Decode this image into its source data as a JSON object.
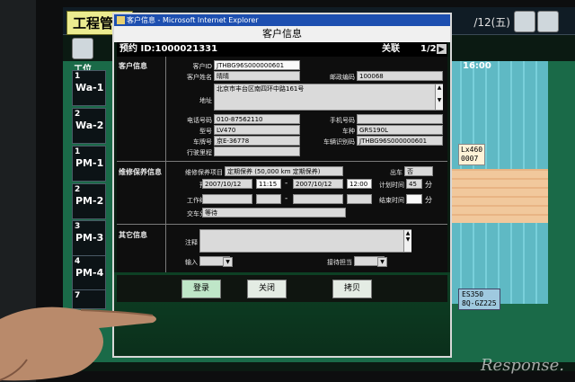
{
  "background_app": {
    "title": "工程管理",
    "date": "/12(五)",
    "time_label": "16:00",
    "column_header": "工位",
    "rows": [
      {
        "num": "1",
        "label": "Wa-1"
      },
      {
        "num": "2",
        "label": "Wa-2"
      },
      {
        "num": "1",
        "label": "PM-1"
      },
      {
        "num": "2",
        "label": "PM-2"
      },
      {
        "num": "3",
        "label": "PM-3"
      },
      {
        "num": "4",
        "label": "PM-4"
      },
      {
        "num": "7",
        "label": ""
      }
    ],
    "card1": "Lx460\n0007",
    "card2": "ES350\n8Q-GZ225"
  },
  "window": {
    "title": "客户信息 - Microsoft Internet Explorer",
    "header": "客户信息"
  },
  "record": {
    "id_label": "预约 ID:1000021331",
    "close_label": "关联",
    "pager": "1/2",
    "next_icon": "▶"
  },
  "customer": {
    "section": "客户信息",
    "customer_id_label": "客户ID",
    "customer_id": "JTHBG96S000000601",
    "name_label": "客户姓名",
    "name": "晴晴",
    "postcode_label": "邮政编码",
    "postcode": "100068",
    "address_label": "地址",
    "address": "北京市丰台区南四环中路161号",
    "phone_label": "电话号码",
    "phone": "010-87562110",
    "mobile_label": "手机号码",
    "mobile": "",
    "model_label": "型号",
    "model": "LV470",
    "vehicle_type_label": "车种",
    "vehicle_type": "GRS190L",
    "plate_label": "车牌号",
    "plate": "京E-36778",
    "vin_label": "车辆识别码",
    "vin": "JTHBG96S000000601",
    "mileage_label": "行驶里程",
    "mileage": ""
  },
  "maintenance": {
    "section": "维修保养信息",
    "item_label": "维修保养项目",
    "item": "定期保养 (50,000 km 定期保养)",
    "car_out_label": "出车",
    "car_out": "否",
    "reserve_label": "预约",
    "reserve_date_from": "2007/10/12",
    "reserve_time_from": "11:15",
    "reserve_date_to": "2007/10/12",
    "reserve_time_to": "12:00",
    "plan_time_label": "计划时间",
    "plan_time": "45",
    "plan_unit": "分",
    "work_label": "工作结束",
    "work_from_date": "",
    "work_from_time": "",
    "work_to_date": "",
    "work_to_time": "",
    "actual_time_label": "结束时间",
    "actual_time": "",
    "actual_unit": "分",
    "handover_label": "交车分类",
    "handover": "等待",
    "dash": "-"
  },
  "other": {
    "section": "其它信息",
    "note_label": "注释",
    "note": "",
    "input_label": "输入",
    "input_value": "",
    "service_label": "接待担当",
    "service_value": ""
  },
  "buttons": {
    "register": "登录",
    "close": "关闭",
    "copy": "拷贝"
  },
  "watermark": "Response."
}
